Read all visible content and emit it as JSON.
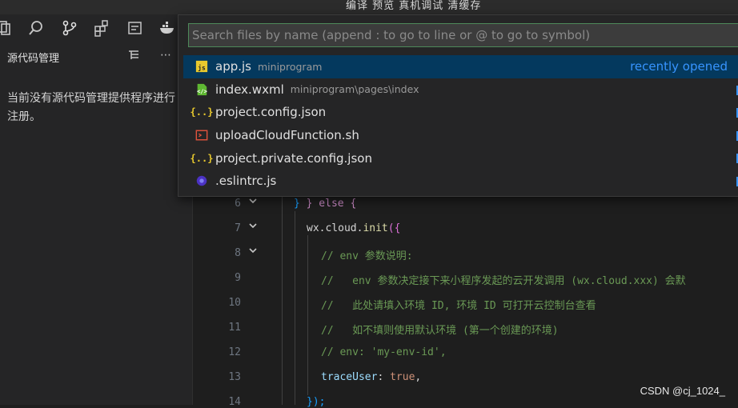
{
  "titlebar": {
    "text": "编译  预览  真机调试  清缓存"
  },
  "sidebar": {
    "title": "源代码管理",
    "message": "当前没有源代码管理提供程序进行注册。"
  },
  "quick_open": {
    "placeholder": "Search files by name (append : to go to line or @ to go to symbol)",
    "items": [
      {
        "name": "app.js",
        "path": "miniprogram",
        "badge": "recently opened",
        "icon": "js-icon",
        "selected": true
      },
      {
        "name": "index.wxml",
        "path": "miniprogram\\pages\\index",
        "badge": "",
        "icon": "wxml-icon"
      },
      {
        "name": "project.config.json",
        "path": "",
        "badge": "",
        "icon": "json-icon"
      },
      {
        "name": "uploadCloudFunction.sh",
        "path": "",
        "badge": "",
        "icon": "shell-icon"
      },
      {
        "name": "project.private.config.json",
        "path": "",
        "badge": "",
        "icon": "json-icon"
      },
      {
        "name": ".eslintrc.js",
        "path": "",
        "badge": "",
        "icon": "eslint-icon"
      }
    ]
  },
  "editor": {
    "line_numbers": [
      "6",
      "7",
      "8",
      "9",
      "10",
      "11",
      "12",
      "13",
      "14"
    ],
    "code": {
      "l6": "} else {",
      "l7_obj": "wx.cloud.",
      "l7_fn": "init",
      "l7_open": "({",
      "l8": "// env 参数说明:",
      "l9": "//   env 参数决定接下来小程序发起的云开发调用 (wx.cloud.xxx) 会默",
      "l10": "//   此处请填入环境 ID, 环境 ID 可打开云控制台查看",
      "l11": "//   如不填则使用默认环境 (第一个创建的环境)",
      "l12": "// env: 'my-env-id',",
      "l13_key": "traceUser",
      "l13_colon": ": ",
      "l13_val": "true",
      "l13_comma": ",",
      "l14": "});"
    }
  },
  "watermark": "CSDN @cj_1024_"
}
